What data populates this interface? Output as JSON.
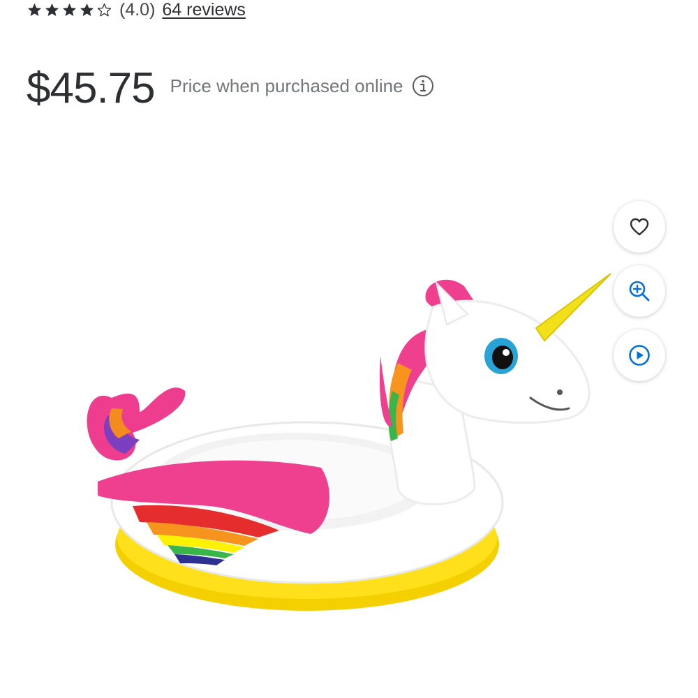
{
  "rating": {
    "stars_filled": 4,
    "stars_total": 5,
    "value_text": "(4.0)",
    "reviews_text": "64 reviews"
  },
  "price": {
    "amount": "$45.75",
    "note": "Price when purchased online",
    "info_icon": "info-icon"
  },
  "product_image": {
    "alt": "Inflatable unicorn pool float"
  },
  "actions": {
    "favorite_icon": "heart-icon",
    "zoom_icon": "zoom-in-icon",
    "video_icon": "play-icon",
    "accent_color": "#0071dc"
  }
}
